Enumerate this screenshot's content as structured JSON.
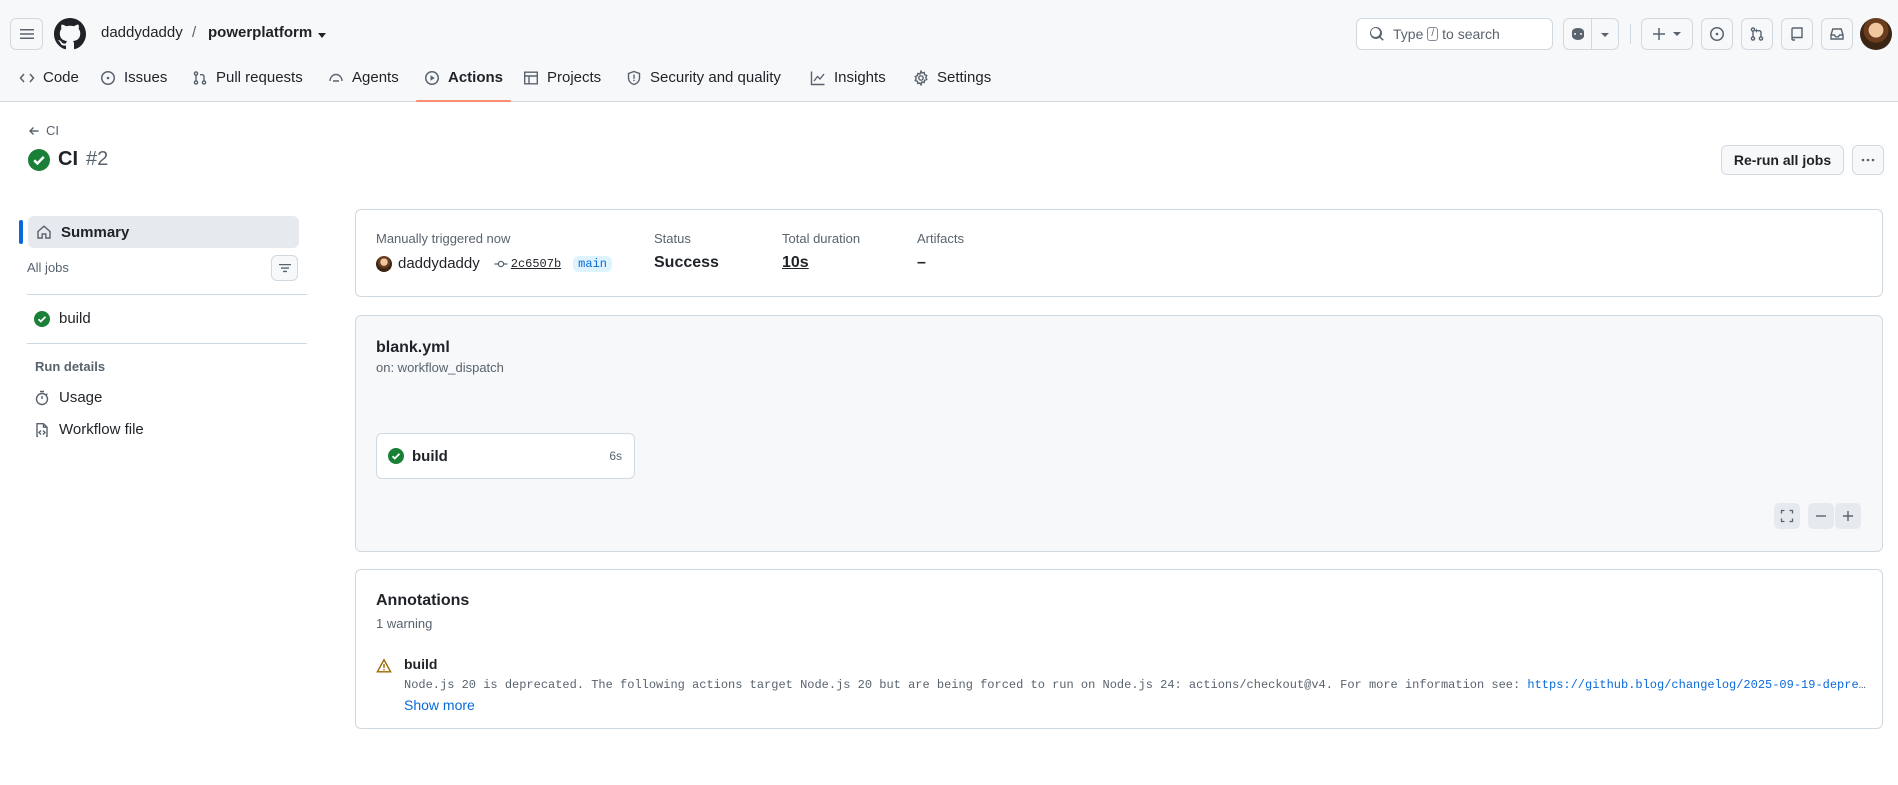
{
  "header": {
    "owner": "daddydaddy",
    "separator": "/",
    "repo": "powerplatform",
    "search": {
      "prefix": "Type",
      "key": "/",
      "suffix": "to search"
    }
  },
  "tabs": [
    {
      "label": "Code",
      "icon": "code-icon"
    },
    {
      "label": "Issues",
      "icon": "issue-icon"
    },
    {
      "label": "Pull requests",
      "icon": "pull-request-icon"
    },
    {
      "label": "Agents",
      "icon": "agents-icon"
    },
    {
      "label": "Actions",
      "icon": "play-icon",
      "selected": true
    },
    {
      "label": "Projects",
      "icon": "table-icon"
    },
    {
      "label": "Security and quality",
      "icon": "shield-icon"
    },
    {
      "label": "Insights",
      "icon": "graph-icon"
    },
    {
      "label": "Settings",
      "icon": "gear-icon"
    }
  ],
  "run": {
    "back_label": "CI",
    "name": "CI",
    "number": "#2",
    "rerun_label": "Re-run all jobs"
  },
  "sidebar": {
    "summary_label": "Summary",
    "all_jobs_label": "All jobs",
    "jobs": [
      {
        "label": "build",
        "status": "success"
      }
    ],
    "run_details_label": "Run details",
    "details": [
      {
        "label": "Usage",
        "icon": "stopwatch-icon"
      },
      {
        "label": "Workflow file",
        "icon": "file-code-icon"
      }
    ]
  },
  "summary": {
    "trigger_label": "Manually triggered now",
    "actor": "daddydaddy",
    "commit": "2c6507b",
    "branch": "main",
    "status_label": "Status",
    "status_value": "Success",
    "duration_label": "Total duration",
    "duration_value": "10s",
    "artifacts_label": "Artifacts",
    "artifacts_value": "–"
  },
  "workflow": {
    "file": "blank.yml",
    "trigger": "on: workflow_dispatch",
    "job": {
      "name": "build",
      "duration": "6s"
    }
  },
  "annotations": {
    "title": "Annotations",
    "count": "1 warning",
    "items": [
      {
        "job": "build",
        "message": "Node.js 20 is deprecated. The following actions target Node.js 20 but are being forced to run on Node.js 24: actions/checkout@v4. For more information see: ",
        "link": "https://github.blog/changelog/2025-09-19-deprecation-of-node-20-on-github-actions-runners/",
        "show_more": "Show more"
      }
    ]
  },
  "colors": {
    "success": "#1a7f37",
    "accent": "#0969da",
    "warning": "#9a6700",
    "tab_underline": "#fd8c73"
  }
}
